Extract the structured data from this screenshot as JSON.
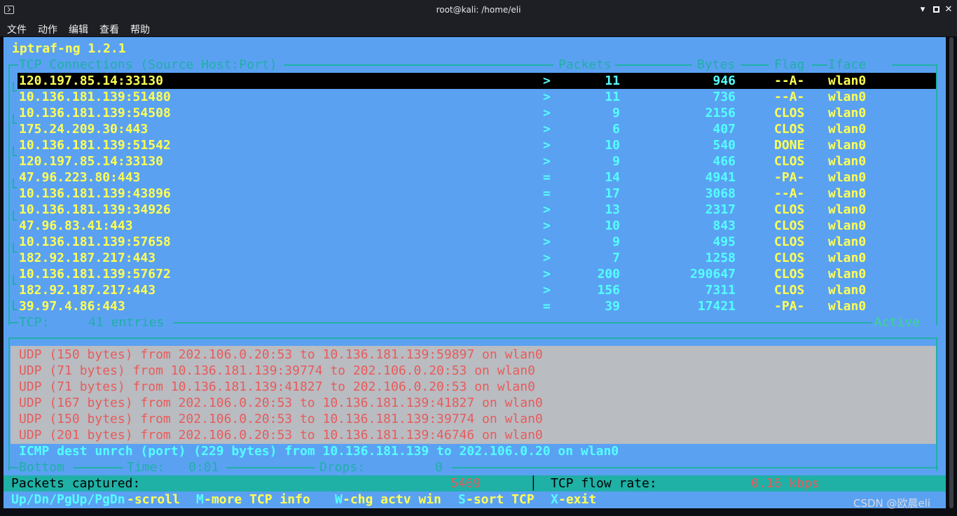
{
  "window": {
    "title": "root@kali: /home/eli",
    "minimize_glyph": "▾",
    "close_glyph": "✕"
  },
  "menu": [
    "文件",
    "动作",
    "编辑",
    "查看",
    "帮助"
  ],
  "app": {
    "title": "iptraf-ng 1.2.1"
  },
  "tcp": {
    "header": {
      "title": "TCP Connections (Source Host:Port)",
      "packets": "Packets",
      "bytes": "Bytes",
      "flag": "Flag",
      "iface": "Iface"
    },
    "rows": [
      {
        "addr": "120.197.85.14:33130",
        "dir": ">",
        "packets": "11",
        "bytes": "946",
        "flag": "--A-",
        "iface": "wlan0"
      },
      {
        "addr": "10.136.181.139:51480",
        "dir": ">",
        "packets": "11",
        "bytes": "736",
        "flag": "--A-",
        "iface": "wlan0"
      },
      {
        "addr": "10.136.181.139:54508",
        "dir": ">",
        "packets": "9",
        "bytes": "2156",
        "flag": "CLOS",
        "iface": "wlan0"
      },
      {
        "addr": "175.24.209.30:443",
        "dir": ">",
        "packets": "6",
        "bytes": "407",
        "flag": "CLOS",
        "iface": "wlan0"
      },
      {
        "addr": "10.136.181.139:51542",
        "dir": ">",
        "packets": "10",
        "bytes": "540",
        "flag": "DONE",
        "iface": "wlan0"
      },
      {
        "addr": "120.197.85.14:33130",
        "dir": ">",
        "packets": "9",
        "bytes": "466",
        "flag": "CLOS",
        "iface": "wlan0"
      },
      {
        "addr": "47.96.223.80:443",
        "dir": "=",
        "packets": "14",
        "bytes": "4941",
        "flag": "-PA-",
        "iface": "wlan0"
      },
      {
        "addr": "10.136.181.139:43896",
        "dir": "=",
        "packets": "17",
        "bytes": "3068",
        "flag": "--A-",
        "iface": "wlan0"
      },
      {
        "addr": "10.136.181.139:34926",
        "dir": ">",
        "packets": "13",
        "bytes": "2317",
        "flag": "CLOS",
        "iface": "wlan0"
      },
      {
        "addr": "47.96.83.41:443",
        "dir": ">",
        "packets": "10",
        "bytes": "843",
        "flag": "CLOS",
        "iface": "wlan0"
      },
      {
        "addr": "10.136.181.139:57658",
        "dir": ">",
        "packets": "9",
        "bytes": "495",
        "flag": "CLOS",
        "iface": "wlan0"
      },
      {
        "addr": "182.92.187.217:443",
        "dir": ">",
        "packets": "7",
        "bytes": "1258",
        "flag": "CLOS",
        "iface": "wlan0"
      },
      {
        "addr": "10.136.181.139:57672",
        "dir": ">",
        "packets": "200",
        "bytes": "290647",
        "flag": "CLOS",
        "iface": "wlan0"
      },
      {
        "addr": "182.92.187.217:443",
        "dir": ">",
        "packets": "156",
        "bytes": "7311",
        "flag": "CLOS",
        "iface": "wlan0"
      },
      {
        "addr": "39.97.4.86:443",
        "dir": "=",
        "packets": "39",
        "bytes": "17421",
        "flag": "-PA-",
        "iface": "wlan0"
      }
    ],
    "footer": {
      "label": "TCP:",
      "entries": "41 entries",
      "state": "Active"
    }
  },
  "udp": {
    "lines": [
      "UDP (150 bytes) from 202.106.0.20:53 to 10.136.181.139:59897 on wlan0",
      "UDP (71 bytes) from 10.136.181.139:39774 to 202.106.0.20:53 on wlan0",
      "UDP (71 bytes) from 10.136.181.139:41827 to 202.106.0.20:53 on wlan0",
      "UDP (167 bytes) from 202.106.0.20:53 to 10.136.181.139:41827 on wlan0",
      "UDP (150 bytes) from 202.106.0.20:53 to 10.136.181.139:39774 on wlan0",
      "UDP (201 bytes) from 202.106.0.20:53 to 10.136.181.139:46746 on wlan0"
    ],
    "icmp": "ICMP dest unrch (port) (229 bytes) from 10.136.181.139 to 202.106.0.20 on wlan0",
    "footer": {
      "bottom": "Bottom",
      "time_label": "Time:",
      "time_value": "0:01",
      "drops_label": "Drops:",
      "drops_value": "0"
    }
  },
  "status": {
    "packets_label": "Packets captured:",
    "packets_value": "5469",
    "separator": "│",
    "rate_label": "TCP flow rate:",
    "rate_value": "0.16 kbps"
  },
  "keys": [
    {
      "key": "Up/Dn/PgUp/PgDn",
      "desc": "-scroll"
    },
    {
      "key": "M",
      "desc": "-more TCP info"
    },
    {
      "key": "W",
      "desc": "-chg actv win"
    },
    {
      "key": "S",
      "desc": "-sort TCP"
    },
    {
      "key": "X",
      "desc": "-exit"
    }
  ],
  "watermark": "CSDN @欧晨eli",
  "colors": {
    "terminal_bg": "#5ba1f2",
    "highlight": "#ffff54",
    "value": "#54ffff",
    "udp_text": "#e85b5b",
    "frame": "#1fb0a6"
  }
}
